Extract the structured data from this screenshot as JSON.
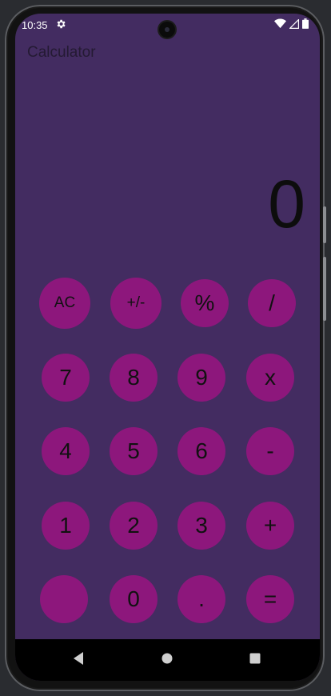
{
  "status_bar": {
    "time": "10:35"
  },
  "app": {
    "title": "Calculator"
  },
  "display": {
    "value": "0"
  },
  "buttons": {
    "ac": "AC",
    "plus_minus": "+/-",
    "percent": "%",
    "divide": "/",
    "seven": "7",
    "eight": "8",
    "nine": "9",
    "multiply": "x",
    "four": "4",
    "five": "5",
    "six": "6",
    "minus": "-",
    "one": "1",
    "two": "2",
    "three": "3",
    "plus": "+",
    "blank": "",
    "zero": "0",
    "dot": ".",
    "equals": "="
  },
  "colors": {
    "background": "#432c61",
    "button": "#8d177c",
    "text": "#111111"
  },
  "icons": [
    "settings-icon",
    "wifi-icon",
    "signal-icon",
    "battery-icon",
    "back-icon",
    "home-icon",
    "recents-icon"
  ]
}
